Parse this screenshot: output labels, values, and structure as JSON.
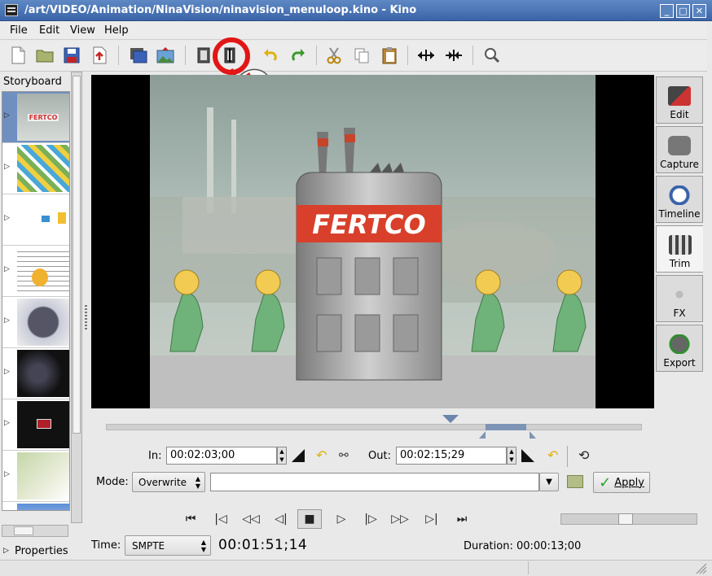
{
  "window": {
    "title": "/art/VIDEO/Animation/NinaVision/ninavision_menuloop.kino - Kino",
    "minimize_label": "_",
    "maximize_label": "□",
    "close_label": "✕"
  },
  "menu": {
    "file": "File",
    "edit": "Edit",
    "view": "View",
    "help": "Help"
  },
  "storyboard": {
    "label": "Storyboard",
    "arrow": "▷",
    "thumb_text": "FERTCO",
    "properties_label": "Properties",
    "properties_arrow": "▷"
  },
  "video": {
    "logo_text": "FERTCO"
  },
  "sidebar": {
    "edit": "Edit",
    "capture": "Capture",
    "timeline": "Timeline",
    "trim": "Trim",
    "fx": "FX",
    "export": "Export"
  },
  "trim": {
    "in_label": "In:",
    "in_value": "00:02:03;00",
    "out_label": "Out:",
    "out_value": "00:02:15;29",
    "mode_label": "Mode:",
    "mode_value": "Overwrite",
    "file_value": "",
    "apply_label": "Apply"
  },
  "bottom": {
    "time_label": "Time:",
    "time_format": "SMPTE",
    "current_time": "00:01:51;14",
    "duration_text": "Duration: 00:00:13;00"
  },
  "colors": {
    "titlebar": "#4a74b5",
    "selection": "#6f8fc0",
    "logo_red": "#d8402b",
    "annotation_red": "#e21616"
  }
}
